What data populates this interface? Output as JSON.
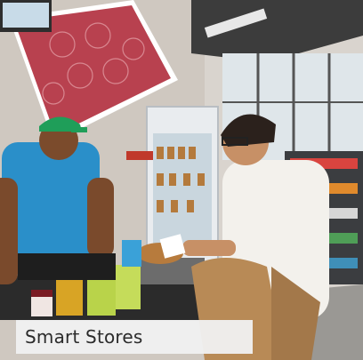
{
  "caption": {
    "label": "Smart Stores"
  },
  "scene": {
    "description_icon": "store-checkout-photo"
  }
}
